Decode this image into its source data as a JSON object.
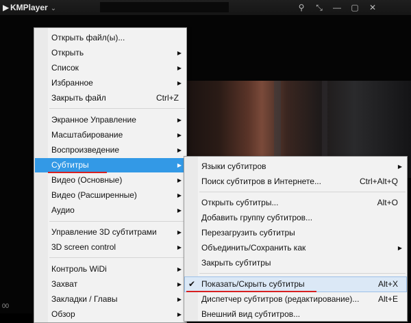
{
  "app": {
    "title": "KMPlayer"
  },
  "status": {
    "time": "00"
  },
  "main_menu": [
    {
      "label": "Открыть файл(ы)...",
      "shortcut": "",
      "arrow": false
    },
    {
      "label": "Открыть",
      "shortcut": "",
      "arrow": true
    },
    {
      "label": "Список",
      "shortcut": "",
      "arrow": true
    },
    {
      "label": "Избранное",
      "shortcut": "",
      "arrow": true
    },
    {
      "label": "Закрыть файл",
      "shortcut": "Ctrl+Z",
      "arrow": false
    },
    {
      "label": "Экранное Управление",
      "shortcut": "",
      "arrow": true
    },
    {
      "label": "Масштабирование",
      "shortcut": "",
      "arrow": true
    },
    {
      "label": "Воспроизведение",
      "shortcut": "",
      "arrow": true
    },
    {
      "label": "Субтитры",
      "shortcut": "",
      "arrow": true
    },
    {
      "label": "Видео (Основные)",
      "shortcut": "",
      "arrow": true
    },
    {
      "label": "Видео (Расширенные)",
      "shortcut": "",
      "arrow": true
    },
    {
      "label": "Аудио",
      "shortcut": "",
      "arrow": true
    },
    {
      "label": "Управление 3D субтитрами",
      "shortcut": "",
      "arrow": true
    },
    {
      "label": "3D screen control",
      "shortcut": "",
      "arrow": true
    },
    {
      "label": "Контроль WiDi",
      "shortcut": "",
      "arrow": true
    },
    {
      "label": "Захват",
      "shortcut": "",
      "arrow": true
    },
    {
      "label": "Закладки / Главы",
      "shortcut": "",
      "arrow": true
    },
    {
      "label": "Обзор",
      "shortcut": "",
      "arrow": true
    }
  ],
  "sub_menu": [
    {
      "label": "Языки субтитров",
      "shortcut": "",
      "arrow": true
    },
    {
      "label": "Поиск субтитров в Интернете...",
      "shortcut": "Ctrl+Alt+Q",
      "arrow": false
    },
    {
      "label": "Открыть субтитры...",
      "shortcut": "Alt+O",
      "arrow": false
    },
    {
      "label": "Добавить группу субтитров...",
      "shortcut": "",
      "arrow": false
    },
    {
      "label": "Перезагрузить субтитры",
      "shortcut": "",
      "arrow": false
    },
    {
      "label": "Объединить/Сохранить как",
      "shortcut": "",
      "arrow": true
    },
    {
      "label": "Закрыть субтитры",
      "shortcut": "",
      "arrow": false
    },
    {
      "label": "Показать/Скрыть субтитры",
      "shortcut": "Alt+X",
      "arrow": false,
      "checked": true
    },
    {
      "label": "Диспетчер субтитров (редактирование)...",
      "shortcut": "Alt+E",
      "arrow": false
    },
    {
      "label": "Внешний вид субтитров...",
      "shortcut": "",
      "arrow": false
    }
  ],
  "icons": {
    "pin": "pin-icon",
    "mini": "mini-mode-icon",
    "minimize": "minimize-icon",
    "maximize": "maximize-icon",
    "close": "close-icon",
    "check": "checkmark-icon"
  },
  "colors": {
    "highlight": "#3399e6",
    "underline": "#d81f1f"
  }
}
